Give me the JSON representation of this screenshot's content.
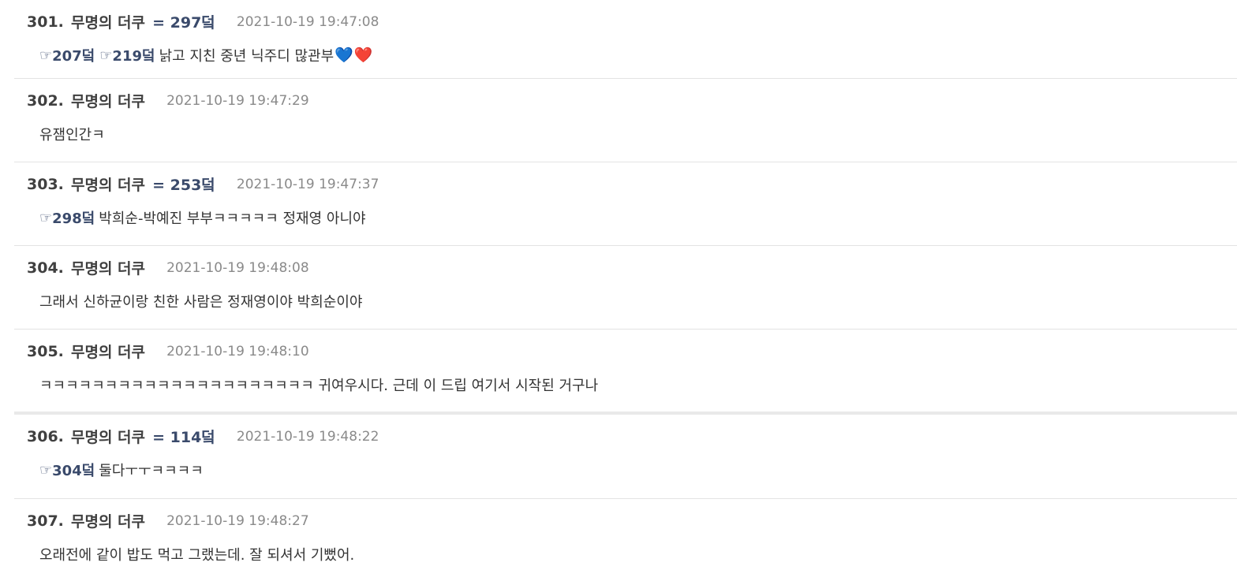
{
  "posts": [
    {
      "number": "301.",
      "author": "무명의 더쿠",
      "reply_to": "= 297덬",
      "date": "2021-10-19 19:47:08",
      "anchors": [
        {
          "hand": "☞",
          "ref": "207덬"
        },
        {
          "hand": "☞",
          "ref": "219덬"
        }
      ],
      "text": "낡고 지친 중년 닉주디 많관부",
      "emoji": [
        "💙",
        "❤️"
      ]
    },
    {
      "number": "302.",
      "author": "무명의 더쿠",
      "reply_to": "",
      "date": "2021-10-19 19:47:29",
      "anchors": [],
      "text": "유잼인간ㅋ"
    },
    {
      "number": "303.",
      "author": "무명의 더쿠",
      "reply_to": "= 253덬",
      "date": "2021-10-19 19:47:37",
      "anchors": [
        {
          "hand": "☞",
          "ref": "298덬"
        }
      ],
      "text": "박희순-박예진 부부ㅋㅋㅋㅋㅋ 정재영 아니야"
    },
    {
      "number": "304.",
      "author": "무명의 더쿠",
      "reply_to": "",
      "date": "2021-10-19 19:48:08",
      "anchors": [],
      "text": "그래서 신하균이랑 친한 사람은 정재영이야 박희순이야"
    },
    {
      "number": "305.",
      "author": "무명의 더쿠",
      "reply_to": "",
      "date": "2021-10-19 19:48:10",
      "anchors": [],
      "text": "ㅋㅋㅋㅋㅋㅋㅋㅋㅋㅋㅋㅋㅋㅋㅋㅋㅋㅋㅋㅋㅋ 귀여우시다. 근데 이 드립 여기서 시작된 거구나"
    },
    {
      "number": "306.",
      "author": "무명의 더쿠",
      "reply_to": "= 114덬",
      "date": "2021-10-19 19:48:22",
      "anchors": [
        {
          "hand": "☞",
          "ref": "304덬"
        }
      ],
      "text": "둘다ㅜㅜㅋㅋㅋㅋ"
    },
    {
      "number": "307.",
      "author": "무명의 더쿠",
      "reply_to": "",
      "date": "2021-10-19 19:48:27",
      "anchors": [],
      "text": "오래전에 같이 밥도 먹고 그랬는데. 잘 되셔서 기뻤어."
    }
  ],
  "colors": {
    "reference_link": "#3a4a6b",
    "date_text": "#8a8a8a",
    "separator": "#e3e3e3",
    "heart_blue": "#3c8fe0",
    "heart_red": "#e0262f"
  }
}
